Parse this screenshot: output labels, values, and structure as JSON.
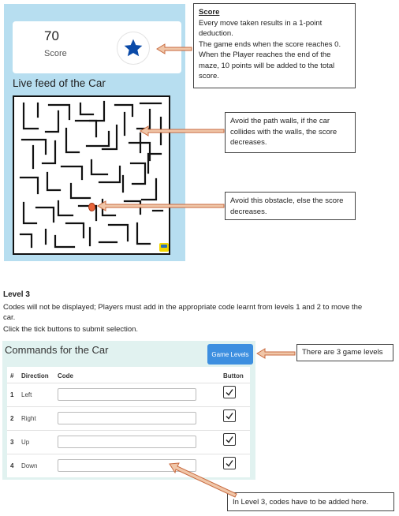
{
  "score_panel": {
    "value": "70",
    "label": "Score",
    "icon": "star-icon",
    "feed_title": "Live feed of the Car"
  },
  "callouts": {
    "score": {
      "title": "Score",
      "lines": [
        "Every move taken results in a 1-point deduction.",
        "The game ends when the score reaches 0.",
        "When the Player reaches the end of the maze, 10 points will be added to the total score."
      ]
    },
    "walls": "Avoid the path walls, if the car collides with the walls, the score decreases.",
    "obstacle": "Avoid this obstacle, else the score decreases.",
    "levels": "There are 3 game levels",
    "codes": "In Level 3, codes have to be added here."
  },
  "level": {
    "title": "Level 3",
    "description": "Codes will not be displayed; Players must add in the appropriate code learnt from levels 1 and 2 to move the car.",
    "instruction": "Click the tick buttons to submit selection."
  },
  "commands": {
    "title": "Commands for the Car",
    "game_levels_label": "Game Levels",
    "columns": {
      "num": "#",
      "direction": "Direction",
      "code": "Code",
      "button": "Button"
    },
    "rows": [
      {
        "num": "1",
        "direction": "Left",
        "code": ""
      },
      {
        "num": "2",
        "direction": "Right",
        "code": ""
      },
      {
        "num": "3",
        "direction": "Up",
        "code": ""
      },
      {
        "num": "4",
        "direction": "Down",
        "code": ""
      }
    ]
  },
  "colors": {
    "panel_bg": "#b7def0",
    "star": "#0a4aa8",
    "button": "#3d8fe0",
    "arrow": "#d9825b",
    "obstacle": "#e8643a",
    "car": "#f2d600"
  }
}
